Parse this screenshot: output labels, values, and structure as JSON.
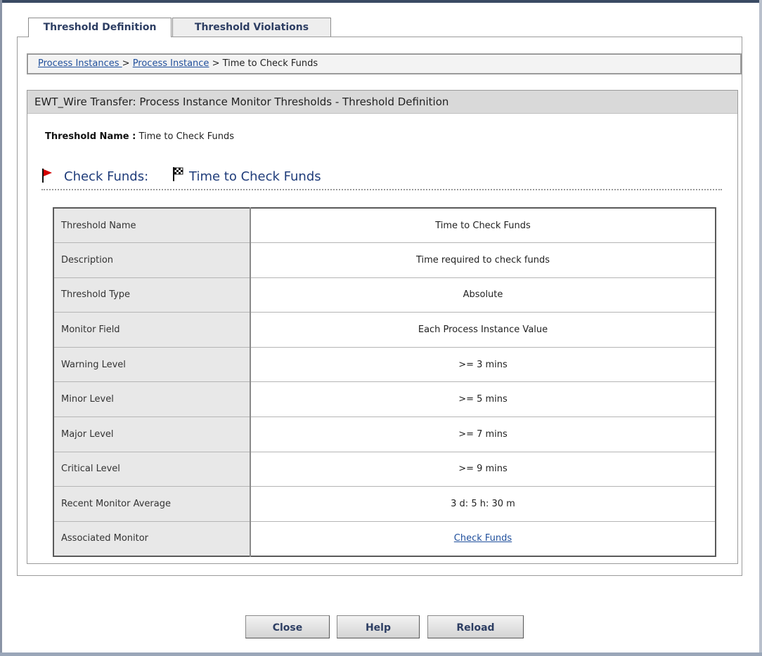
{
  "tabs": [
    {
      "label": "Threshold Definition",
      "active": true
    },
    {
      "label": "Threshold Violations",
      "active": false
    }
  ],
  "breadcrumb": {
    "items": [
      "Process Instances ",
      "Process Instance",
      "Time to Check Funds"
    ],
    "separator": " > "
  },
  "content": {
    "header": "EWT_Wire Transfer: Process Instance Monitor Thresholds - Threshold Definition",
    "threshold_name_label": "Threshold Name :",
    "threshold_name_value": "Time to Check Funds",
    "flag_start_label": "Check Funds:",
    "flag_end_label": "Time to Check Funds"
  },
  "table": {
    "rows": [
      {
        "label": "Threshold Name",
        "value": "Time to Check Funds"
      },
      {
        "label": "Description",
        "value": "Time required to check funds"
      },
      {
        "label": "Threshold Type",
        "value": "Absolute"
      },
      {
        "label": "Monitor Field",
        "value": "Each Process Instance Value"
      },
      {
        "label": "Warning Level",
        "value": ">= 3 mins"
      },
      {
        "label": "Minor Level",
        "value": ">= 5 mins"
      },
      {
        "label": "Major Level",
        "value": ">= 7 mins"
      },
      {
        "label": "Critical Level",
        "value": ">= 9 mins"
      },
      {
        "label": "Recent Monitor Average",
        "value": "3 d: 5 h: 30 m"
      },
      {
        "label": "Associated Monitor",
        "value": "Check Funds"
      }
    ]
  },
  "buttons": {
    "close": "Close",
    "help": "Help",
    "reload": "Reload"
  },
  "icons": {
    "start_flag": "red-flag-icon",
    "end_flag": "checkered-flag-icon"
  },
  "colors": {
    "link": "#1f4f9c",
    "header_bg": "#d9d9d9",
    "label_bg": "#e8e8e8",
    "flag_red": "#d40000"
  }
}
